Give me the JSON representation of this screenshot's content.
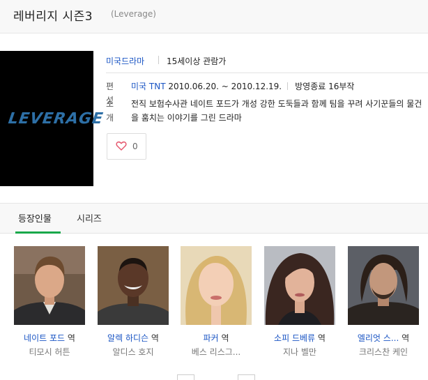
{
  "header": {
    "title": "레버리지 시즌3",
    "subtitle": "(Leverage)"
  },
  "poster": {
    "logo_text": "LEVERAGE"
  },
  "info": {
    "genre": "미국드라마",
    "rating": "15세이상 관람가",
    "schedule_label": "편성",
    "network": "미국 TNT",
    "air_dates": "2010.06.20. ~ 2010.12.19.",
    "status": "방영종료 16부작",
    "intro_label": "소개",
    "description": "전직 보험수사관 네이트 포드가 개성 강한 도둑들과 함께 팀을 꾸려 사기꾼들의 물건을 훔치는 이야기를 그린 드라마"
  },
  "like": {
    "count": "0",
    "icon": "heart-icon"
  },
  "tabs": [
    {
      "label": "등장인물"
    },
    {
      "label": "시리즈"
    }
  ],
  "cast": [
    {
      "character": "네이트 포드",
      "suffix": "역",
      "actor": "티모시 허튼"
    },
    {
      "character": "알렉 하디슨",
      "suffix": "역",
      "actor": "알디스 호지"
    },
    {
      "character": "파커",
      "suffix": "역",
      "actor": "베스 리스그..."
    },
    {
      "character": "소피 드베류",
      "suffix": "역",
      "actor": "지나 벨만"
    },
    {
      "character": "엘리엇 스...",
      "suffix": "역",
      "actor": "크리스찬 케인"
    }
  ],
  "colors": {
    "link": "#1a55c4",
    "tab_accent": "#19a84b",
    "heart": "#e5546b"
  }
}
